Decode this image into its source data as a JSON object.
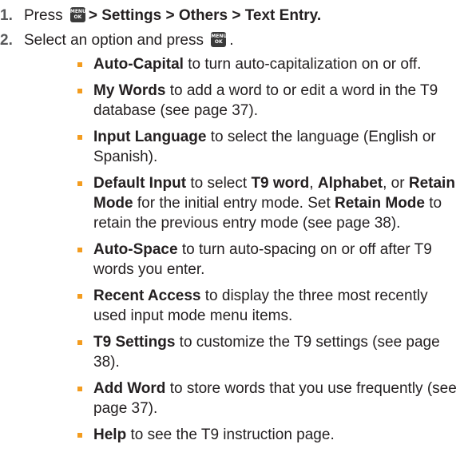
{
  "steps": [
    {
      "number": "1.",
      "press_text": "Press",
      "key_icon": "menu-ok-key-icon",
      "key_label_top": "MENU",
      "key_label_bottom": "OK",
      "path": "> Settings > Others > Text Entry",
      "end": "."
    },
    {
      "number": "2.",
      "text": "Select an option and press",
      "key_icon": "menu-ok-key-icon",
      "key_label_top": "MENU",
      "key_label_bottom": "OK",
      "end": "."
    }
  ],
  "bullet_color": "#f39c1f",
  "options": [
    {
      "name": "Auto-Capital",
      "desc": " to turn auto-capitalization on or off."
    },
    {
      "name": "My Words",
      "desc": " to add a word to or edit a word in the T9 database (see page 37)."
    },
    {
      "name": "Input Language",
      "desc": " to select the language (English or Spanish)."
    },
    {
      "name": "Default Input",
      "desc_a": " to select ",
      "b1": "T9 word",
      "c1": ", ",
      "b2": "Alphabet",
      "c2": ", or ",
      "b3": "Retain Mode",
      "c3": " for the initial entry mode. Set ",
      "b4": "Retain Mode",
      "c4": " to retain the previous entry mode (see page 38)."
    },
    {
      "name": "Auto-Space",
      "desc": " to turn auto-spacing on or off after T9 words you enter."
    },
    {
      "name": "Recent Access",
      "desc": " to display the three most recently used input mode menu items."
    },
    {
      "name": "T9 Settings",
      "desc": " to customize the T9 settings (see page 38)."
    },
    {
      "name": "Add Word",
      "desc": " to store words that you use frequently (see page 37)."
    },
    {
      "name": "Help",
      "desc": " to see the T9 instruction page."
    }
  ]
}
